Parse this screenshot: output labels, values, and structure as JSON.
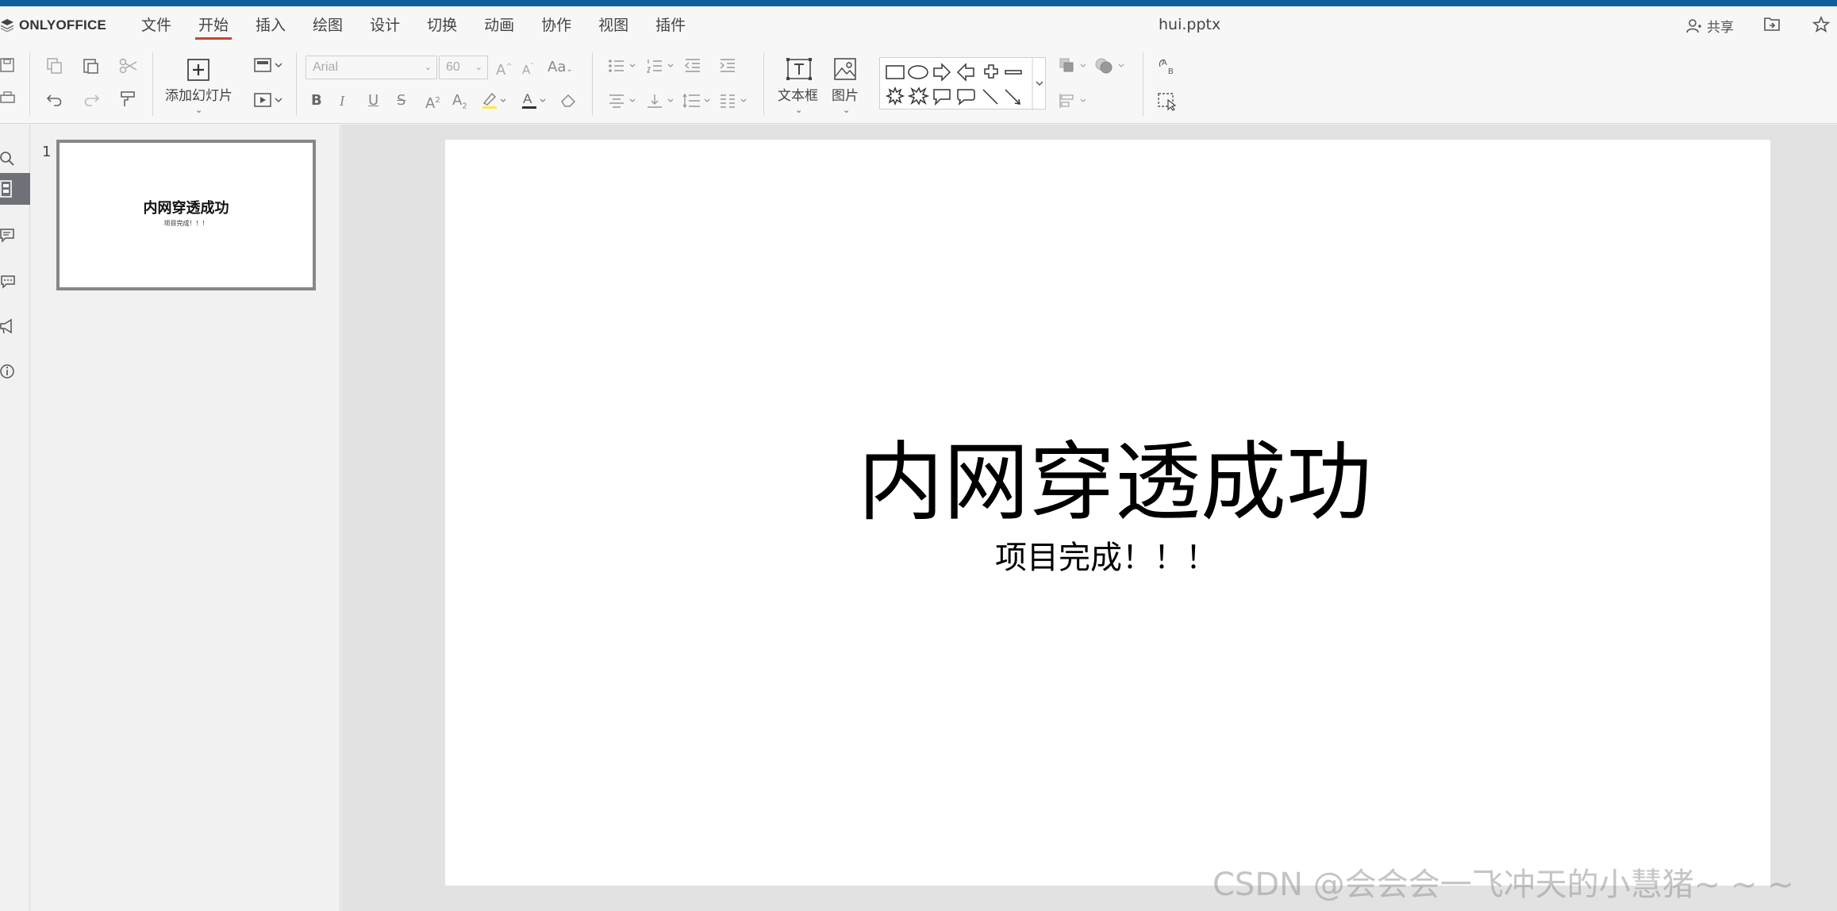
{
  "app": {
    "name": "ONLYOFFICE",
    "document_title": "hui.pptx"
  },
  "menu": {
    "tabs": [
      "文件",
      "开始",
      "插入",
      "绘图",
      "设计",
      "切换",
      "动画",
      "协作",
      "视图",
      "插件"
    ],
    "active": "开始"
  },
  "header": {
    "share_label": "共享"
  },
  "toolbar": {
    "add_slide_label": "添加幻灯片",
    "font_name": "Arial",
    "font_size": "60",
    "textbox_label": "文本框",
    "image_label": "图片"
  },
  "slides": [
    {
      "number": "1",
      "title": "内网穿透成功",
      "subtitle": "项目完成！！！"
    }
  ],
  "current_slide": {
    "title": "内网穿透成功",
    "subtitle": "项目完成！！！"
  },
  "watermark": "CSDN @会会会一飞冲天的小慧猪~ ~ ~",
  "colors": {
    "accent": "#c4452e",
    "topbar": "#0f5e9c",
    "rail_active": "#6e7278"
  }
}
